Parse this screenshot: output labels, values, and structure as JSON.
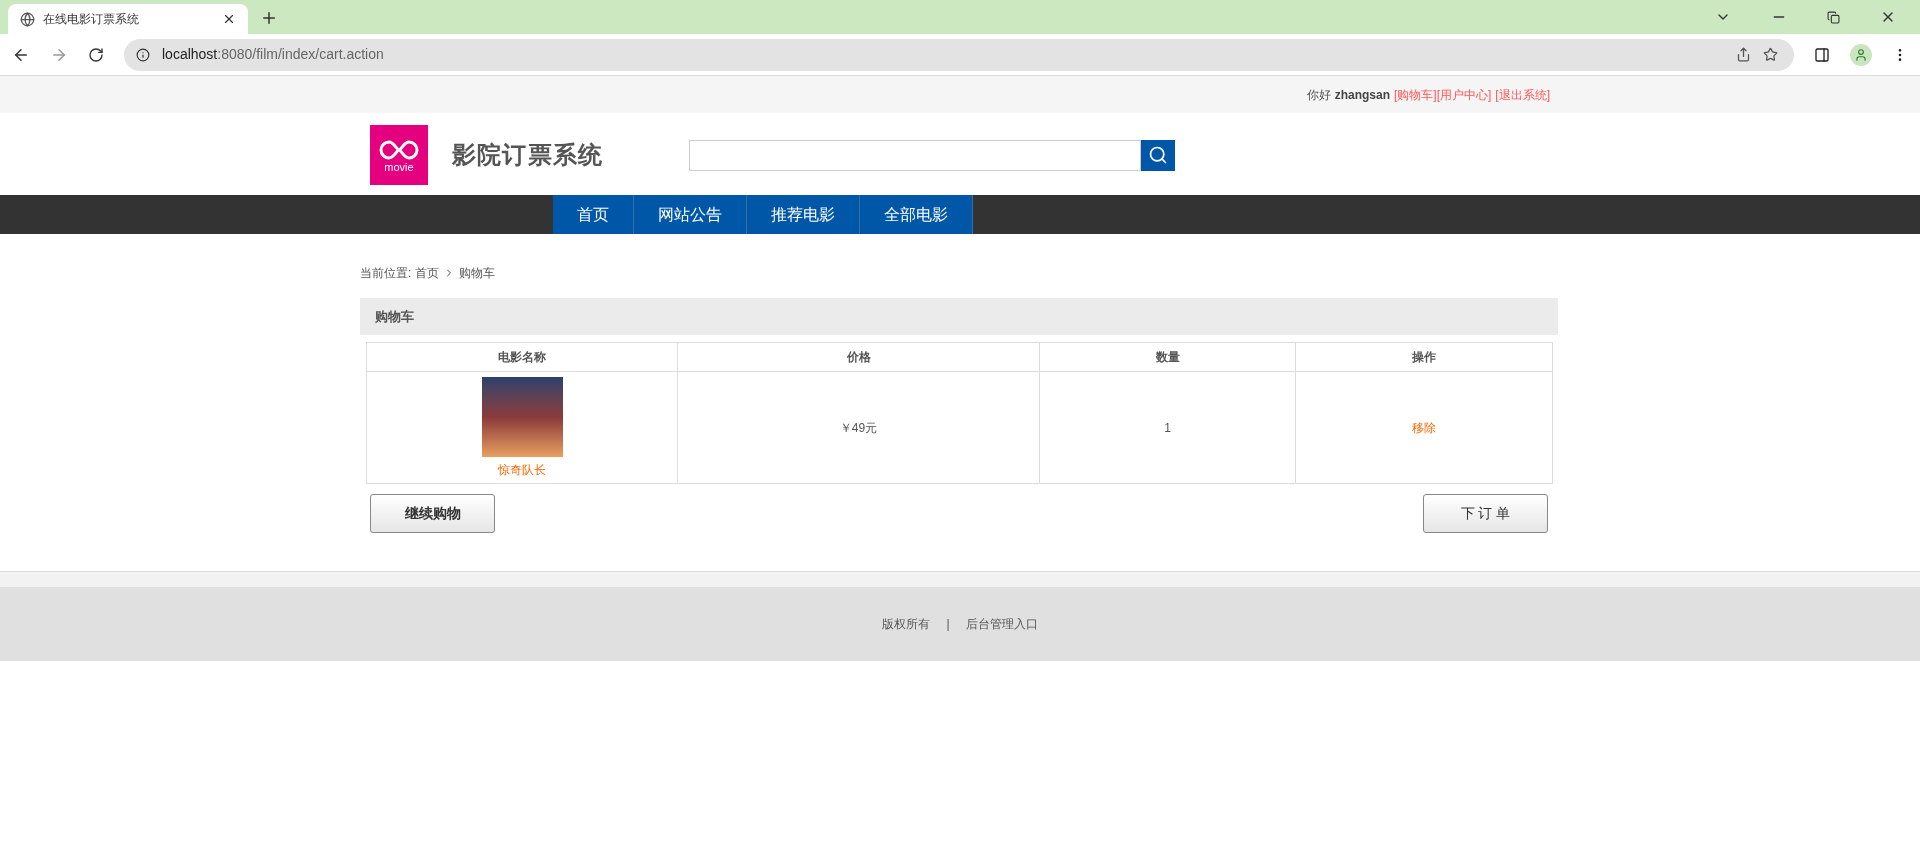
{
  "browser": {
    "tab_title": "在线电影订票系统",
    "url_host": "localhost",
    "url_rest": ":8080/film/index/cart.action"
  },
  "topbar": {
    "greeting": "你好",
    "username": "zhangsan",
    "links": [
      "[购物车]",
      "[用户中心]",
      "[退出系统]"
    ]
  },
  "header": {
    "site_title": "影院订票系统",
    "logo_text": "movie"
  },
  "nav": [
    "首页",
    "网站公告",
    "推荐电影",
    "全部电影"
  ],
  "breadcrumb": {
    "label": "当前位置:",
    "items": [
      "首页",
      "购物车"
    ]
  },
  "cart": {
    "title": "购物车",
    "columns": [
      "电影名称",
      "价格",
      "数量",
      "操作"
    ],
    "rows": [
      {
        "film": "惊奇队长",
        "price": "￥49元",
        "quantity": "1",
        "action": "移除"
      }
    ]
  },
  "buttons": [
    "继续购物",
    "下 订 单"
  ],
  "footer": {
    "links": [
      "版权所有",
      "后台管理入口"
    ],
    "separator": "|"
  }
}
